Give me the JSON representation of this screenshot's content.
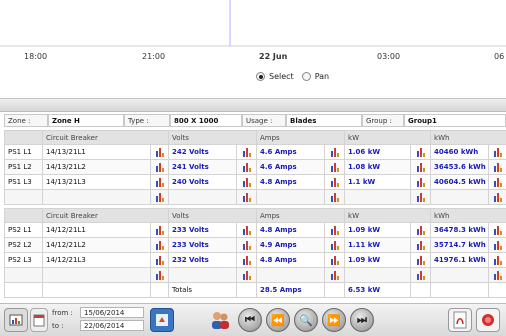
{
  "timeline": {
    "ticks": [
      "18:00",
      "21:00",
      "22 Jun",
      "03:00",
      "06"
    ],
    "mode_options": [
      {
        "label": "Select",
        "selected": true
      },
      {
        "label": "Pan",
        "selected": false
      }
    ]
  },
  "info": {
    "zone_key": "Zone :",
    "zone_value": "Zone H",
    "type_key": "Type :",
    "type_value": "800 X 1000",
    "usage_key": "Usage :",
    "usage_value": "Blades",
    "group_key": "Group :",
    "group_value": "Group1"
  },
  "table1": {
    "headers": [
      "Circuit Breaker",
      "Volts",
      "Amps",
      "kW",
      "kWh"
    ],
    "rows": [
      {
        "name": "PS1 L1",
        "breaker": "14/13/21L1",
        "volts": "242 Volts",
        "amps": "4.6 Amps",
        "kw": "1.06 kW",
        "kwh": "40460 kWh"
      },
      {
        "name": "PS1 L2",
        "breaker": "14/13/21L2",
        "volts": "241 Volts",
        "amps": "4.6 Amps",
        "kw": "1.08 kW",
        "kwh": "36453.6 kWh"
      },
      {
        "name": "PS1 L3",
        "breaker": "14/13/21L3",
        "volts": "240 Volts",
        "amps": "4.8 Amps",
        "kw": "1.1 kW",
        "kwh": "40604.5 kWh"
      }
    ]
  },
  "table2": {
    "headers": [
      "Circuit Breaker",
      "Volts",
      "Amps",
      "kW",
      "kWh"
    ],
    "rows": [
      {
        "name": "PS2 L1",
        "breaker": "14/12/21L1",
        "volts": "233 Volts",
        "amps": "4.8 Amps",
        "kw": "1.09 kW",
        "kwh": "36478.3 kWh"
      },
      {
        "name": "PS2 L2",
        "breaker": "14/12/21L2",
        "volts": "233 Volts",
        "amps": "4.9 Amps",
        "kw": "1.11 kW",
        "kwh": "35714.7 kWh"
      },
      {
        "name": "PS2 L3",
        "breaker": "14/12/21L3",
        "volts": "232 Volts",
        "amps": "4.8 Amps",
        "kw": "1.09 kW",
        "kwh": "41976.1 kWh"
      }
    ],
    "totals": {
      "label": "Totals",
      "amps": "28.5 Amps",
      "kw": "6.53 kW"
    }
  },
  "toolbar": {
    "from_label": "from :",
    "from_value": "15/06/2014",
    "to_label": "to :",
    "to_value": "22/06/2014"
  },
  "icons": [
    "bar-chart-icon",
    "calendar-icon",
    "export-icon",
    "users-icon",
    "first-page-icon",
    "rewind-icon",
    "zoom-icon",
    "forward-icon",
    "last-page-icon",
    "pdf-icon",
    "alarm-icon"
  ]
}
